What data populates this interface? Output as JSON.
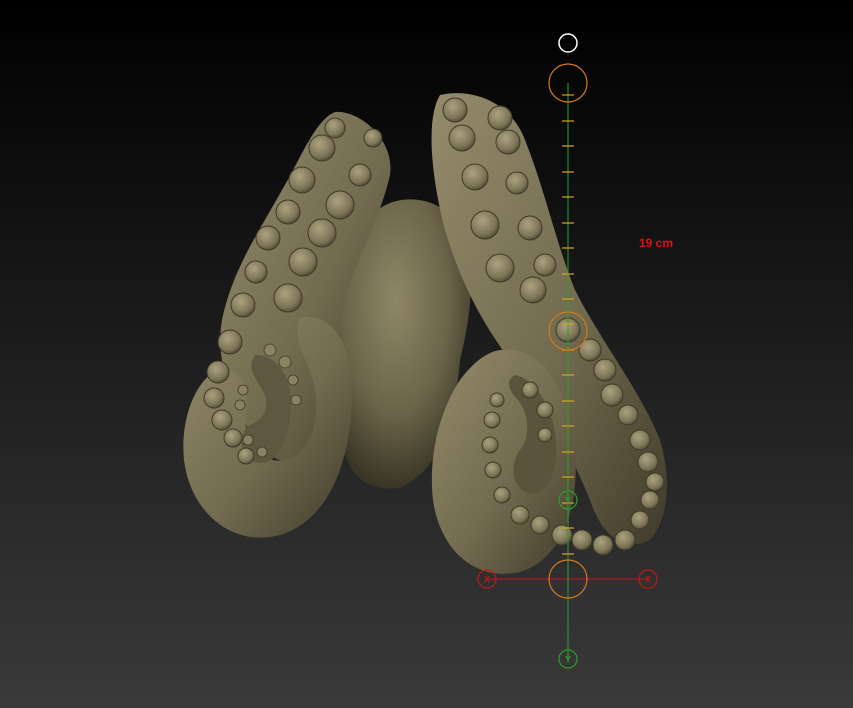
{
  "measurement": {
    "value_label": "19 cm",
    "color": "#e01010"
  },
  "gizmo": {
    "x_axis_label_left": "X",
    "x_axis_label_right": "X",
    "y_axis_label_top": "Y",
    "y_axis_label_bottom": "Y",
    "colors": {
      "x_axis": "#c01818",
      "y_axis": "#2aa02a",
      "rings": "#d07a20",
      "ticks": "#e0a020",
      "top_handle": "#ffffff"
    }
  },
  "model": {
    "name": "octopus-sculpt",
    "color": "#7a7255"
  }
}
